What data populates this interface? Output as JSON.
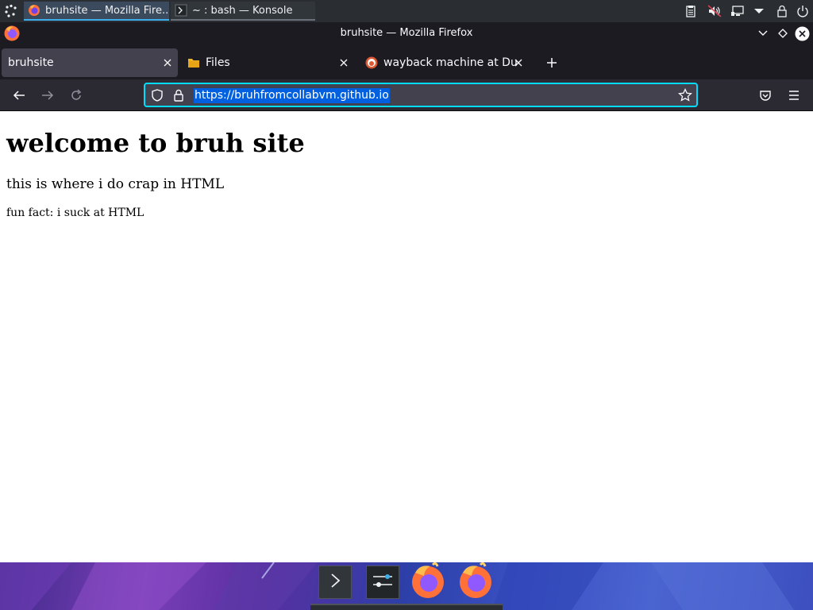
{
  "panel": {
    "tasks": [
      {
        "label": "bruhsite — Mozilla Fire...",
        "icon": "firefox-icon"
      },
      {
        "label": "~ : bash — Konsole",
        "icon": "terminal-icon"
      }
    ],
    "tray_icons": [
      "clipboard-icon",
      "volume-muted-icon",
      "network-icon",
      "expand-tray-icon",
      "lock-icon",
      "power-icon"
    ]
  },
  "window": {
    "title": "bruhsite — Mozilla Firefox"
  },
  "tabs": [
    {
      "label": "bruhsite",
      "active": true,
      "icon": "none"
    },
    {
      "label": "Files",
      "active": false,
      "icon": "folder-icon"
    },
    {
      "label": "wayback machine at Duck",
      "active": false,
      "icon": "duckduckgo-icon"
    }
  ],
  "urlbar": {
    "url": "https://bruhfromcollabvm.github.io"
  },
  "page": {
    "heading": "welcome to bruh site",
    "paragraph1": "this is where i do crap in HTML",
    "paragraph2": "fun fact: i suck at HTML"
  },
  "dock": {
    "items": [
      "terminal-icon",
      "mixer-icon",
      "firefox-icon",
      "firefox-icon"
    ]
  },
  "colors": {
    "panel_bg": "#2a2e32",
    "browser_bg": "#1c1b22",
    "toolbar_bg": "#2b2a33",
    "urlbar_focus": "#00ddff",
    "selection": "#0060df",
    "accent": "#3daee9"
  }
}
